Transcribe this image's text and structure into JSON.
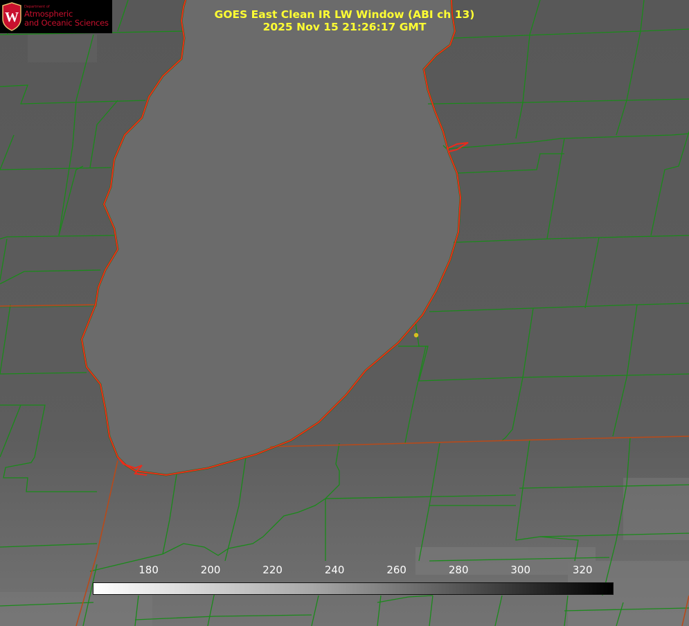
{
  "logo": {
    "department": "Department of",
    "line1": "Atmospheric",
    "line2": "and Oceanic Sciences",
    "crest_letter": "W"
  },
  "title": {
    "line1": "GOES East Clean IR LW Window (ABI ch 13)",
    "line2": "2025 Nov 15 21:26:17 GMT"
  },
  "colorbar": {
    "ticks": [
      "180",
      "200",
      "220",
      "240",
      "260",
      "280",
      "300",
      "320"
    ],
    "min": 162,
    "max": 330
  },
  "colors": {
    "county_lines": "#1a8a1a",
    "shoreline": "#ee2a1a",
    "state_lines": "#b84a1a",
    "marker": "#d8c020",
    "title_text": "#ffff33"
  }
}
